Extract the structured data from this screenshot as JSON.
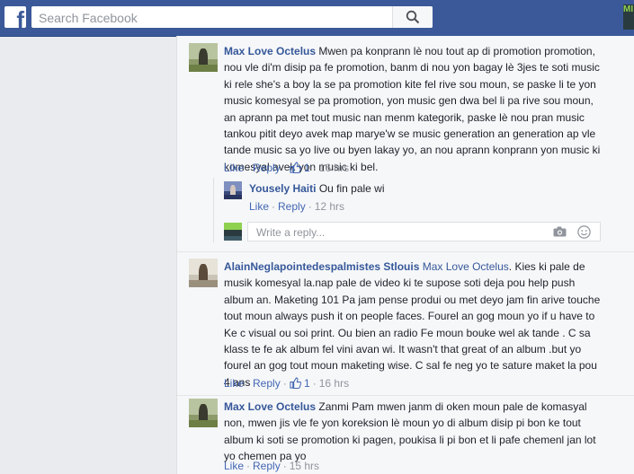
{
  "topbar": {
    "logo_letter": "f",
    "search_placeholder": "Search Facebook",
    "corner_badge": "MI"
  },
  "comments": [
    {
      "author": "Max Love Octelus",
      "text": "Mwen pa konprann lè nou tout ap di promotion promotion, nou vle di'm disip pa fe promotion, banm di nou yon bagay lè 3jes te soti music ki rele she's a boy la se pa promotion kite fel rive sou moun, se paske li te yon music komesyal se pa promotion, yon music gen dwa bel li pa rive sou moun, an aprann pa met tout music nan menm kategorik, paske lè nou pran music tankou pitit deyo avek map marye'w se music generation an generation ap vle tande music sa yo live ou byen lakay yo, an nou aprann konprann yon music ki komesyal avek yon music ki bel.",
      "like": "Like",
      "reply": "Reply",
      "likes_count": "1",
      "time": "16 hrs"
    },
    {
      "author": "Yousely Haiti",
      "text": "Ou fin pale wi",
      "like": "Like",
      "reply": "Reply",
      "time": "12 hrs"
    },
    {
      "author": "AlainNeglapointedespalmistes Stlouis",
      "mention": "Max Love Octelus",
      "text": ". Kies ki pale de musik komesyal la.nap pale de video ki te supose soti deja pou help push album an. Maketing 101 Pa jam pense produi ou met deyo jam fin arive touche tout moun always push it on people faces. Fourel an gog moun yo if u have to Ke c visual ou soi print. Ou bien an radio Fe moun bouke wel ak tande . C sa klass te fe ak album fel vini avan wi. It wasn't that great of an album .but yo fourel an gog tout moun maketing wise. C sal fe neg yo te sature maket la pou 4 ans",
      "like": "Like",
      "reply": "Reply",
      "likes_count": "1",
      "time": "16 hrs"
    },
    {
      "author": "Max Love Octelus",
      "text": "Zanmi Pam mwen janm di oken moun pale de komasyal non, mwen jis vle fe yon koreksion lè moun yo di album disip pi bon ke tout album ki soti se promotion ki pagen, poukisa li pi bon et li pafe chemenl jan lot yo chemen pa yo",
      "like": "Like",
      "reply": "Reply",
      "time": "15 hrs"
    }
  ],
  "reply_box": {
    "placeholder": "Write a reply..."
  },
  "colors": {
    "topbar": "#3b5998",
    "link": "#365899",
    "meta": "#90949c",
    "background": "#e9ebee"
  },
  "icons": [
    "facebook-logo-icon",
    "search-icon",
    "thumbs-up-icon",
    "camera-icon",
    "emoji-icon"
  ]
}
